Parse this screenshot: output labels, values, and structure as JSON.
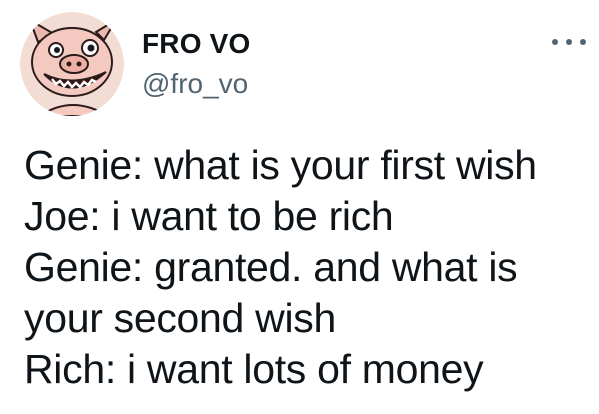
{
  "author": {
    "display_name": "FRO VO",
    "handle": "@fro_vo",
    "avatar_icon": "cartoon-pig-avatar"
  },
  "menu": {
    "icon": "more-options-icon"
  },
  "tweet": {
    "lines": [
      "Genie: what is your first wish",
      "Joe: i want to be rich",
      "Genie: granted. and what is",
      "your second wish",
      "Rich: i want lots of money"
    ]
  },
  "colors": {
    "text": "#0f1419",
    "secondary_text": "#536471",
    "background": "#ffffff"
  }
}
